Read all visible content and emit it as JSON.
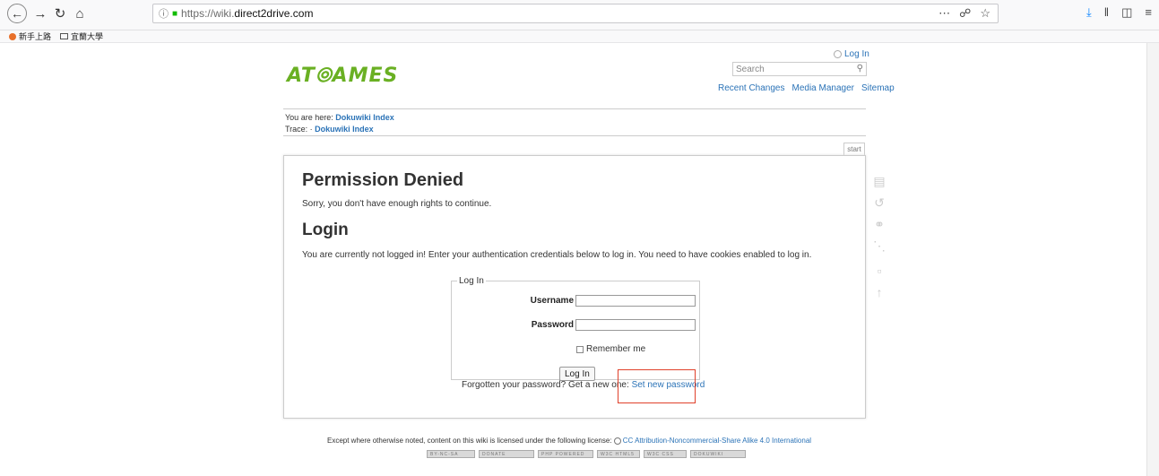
{
  "browser": {
    "url_scheme": "https://wiki.",
    "url_host": "direct2drive.com",
    "bookmarks": [
      "新手上路",
      "宜蘭大學"
    ],
    "accent": "#0a84ff"
  },
  "header": {
    "logo_text": "AT",
    "logo_text2": "AMES",
    "login_link": "Log In",
    "search_placeholder": "Search",
    "links": [
      "Recent Changes",
      "Media Manager",
      "Sitemap"
    ]
  },
  "breadcrumbs": {
    "you_are_here_label": "You are here: ",
    "you_are_here_link": "Dokuwiki Index",
    "trace_label": "Trace: · ",
    "trace_link": "Dokuwiki Index"
  },
  "page_tab": "start",
  "content": {
    "title": "Permission Denied",
    "sorry_text": "Sorry, you don't have enough rights to continue.",
    "login_heading": "Login",
    "login_intro": "You are currently not logged in! Enter your authentication credentials below to log in. You need to have cookies enabled to log in.",
    "form": {
      "legend": "Log In",
      "username_label": "Username",
      "username_value": "",
      "password_label": "Password",
      "password_value": "",
      "remember_label": "Remember me",
      "submit_label": "Log In"
    },
    "forgot_text": "Forgotten your password? Get a new one: ",
    "forgot_link": "Set new password",
    "highlight_color": "#e0412b"
  },
  "footer": {
    "license_text": "Except where otherwise noted, content on this wiki is licensed under the following license: ",
    "license_link": "CC Attribution-Noncommercial-Share Alike 4.0 International",
    "badges": [
      "BY-NC-SA",
      "DONATE",
      "PHP POWERED",
      "W3C HTML5",
      "W3C CSS",
      "DOKUWIKI"
    ]
  },
  "colors": {
    "logo_green": "#6ab023",
    "link_blue": "#2b73b7"
  }
}
